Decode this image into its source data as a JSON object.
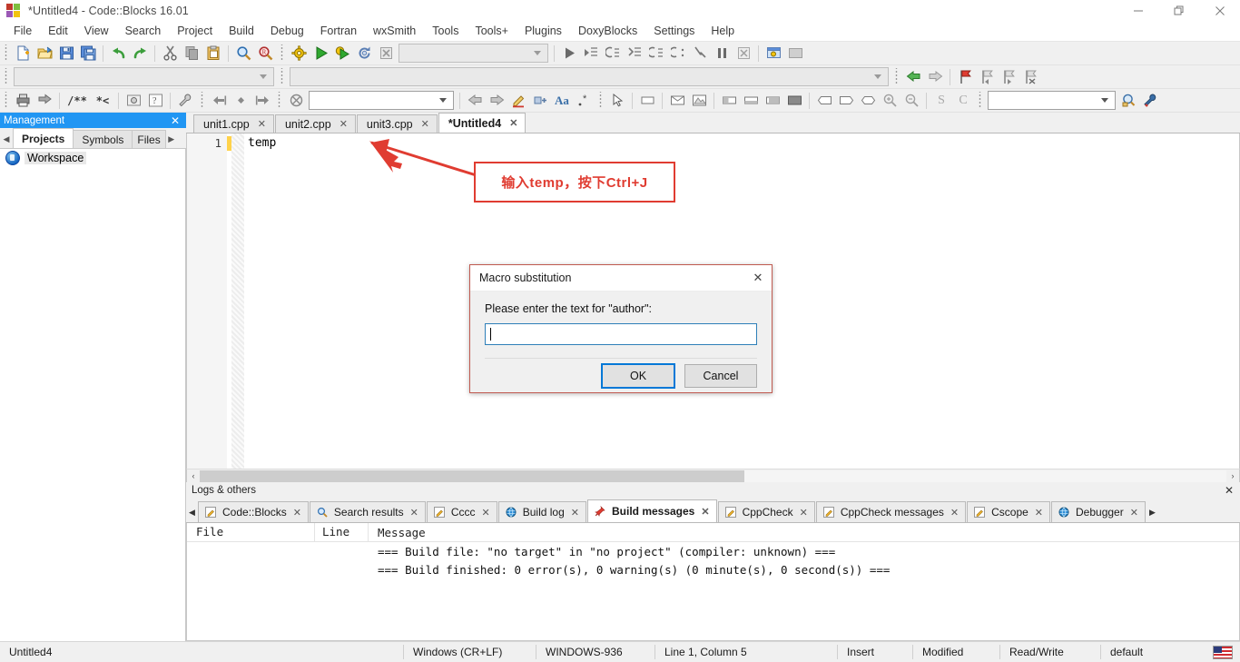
{
  "window": {
    "title": "*Untitled4 - Code::Blocks 16.01",
    "app_icon": "codeblocks-logo-icon",
    "minimize": "—",
    "maximize": "❐",
    "close": "✕"
  },
  "menubar": {
    "items": [
      {
        "label": "File"
      },
      {
        "label": "Edit"
      },
      {
        "label": "View"
      },
      {
        "label": "Search"
      },
      {
        "label": "Project"
      },
      {
        "label": "Build"
      },
      {
        "label": "Debug"
      },
      {
        "label": "Fortran"
      },
      {
        "label": "wxSmith"
      },
      {
        "label": "Tools"
      },
      {
        "label": "Tools+"
      },
      {
        "label": "Plugins"
      },
      {
        "label": "DoxyBlocks"
      },
      {
        "label": "Settings"
      },
      {
        "label": "Help"
      }
    ]
  },
  "toolbars": {
    "main": {
      "buttons": [
        "new-file-icon",
        "open-file-icon",
        "save-icon",
        "save-all-icon",
        "undo-icon",
        "redo-icon",
        "cut-icon",
        "copy-icon",
        "paste-icon",
        "find-icon",
        "replace-icon"
      ]
    },
    "compiler": {
      "buttons": [
        "build-icon",
        "run-icon",
        "build-and-run-icon",
        "rebuild-icon",
        "abort-icon"
      ],
      "target_combo_value": "",
      "target_combo_enabled": false
    },
    "debugger": {
      "buttons": [
        "debug-continue-icon",
        "run-to-cursor-icon",
        "next-line-icon",
        "step-into-icon",
        "step-out-icon",
        "next-instruction-icon",
        "step-into-instruction-icon",
        "break-debugger-icon",
        "stop-debugger-icon",
        "debugging-windows-icon",
        "various-info-icon"
      ]
    },
    "search_row": {
      "combo_value": "",
      "combo_enabled": false,
      "nav_buttons": [
        "back-icon",
        "forward-icon"
      ],
      "bookmark_buttons": [
        "toggle-bookmark-icon",
        "previous-bookmark-icon",
        "next-bookmark-icon",
        "clear-bookmarks-icon"
      ]
    },
    "doxyblocks": {
      "buttons": [
        "run-doxywizard-icon",
        "extract-documentation-icon",
        "block-comment-icon",
        "line-comment-icon",
        "doxywizard-icon",
        "preferences-icon"
      ]
    },
    "fortran": {
      "buttons": [
        "jump-back-icon",
        "jump-home-icon",
        "jump-forward-icon"
      ]
    },
    "wxsmith": {
      "buttons": [
        "wxsmith-icon",
        "back-icon",
        "forward-icon",
        "edit-icon",
        "insert-icon",
        "font-icon",
        "wildcard-icon",
        "pointer-icon",
        "panel-icon",
        "dialog-icon",
        "frame-icon",
        "sizer-h-icon",
        "sizer-v-icon",
        "sizer-grid-icon",
        "sizer-box-icon",
        "spacer-icon",
        "stretch-icon",
        "shape-icon"
      ]
    },
    "browse": {
      "buttons": [
        "zoom-in-icon",
        "zoom-out-icon",
        "symbols-icon",
        "classes-icon"
      ],
      "combo_value": "",
      "combo_enabled": true,
      "extra_buttons": [
        "search-symbol-icon",
        "settings-wrench-icon"
      ]
    }
  },
  "management": {
    "title": "Management",
    "close_icon": "✕",
    "tabs": [
      {
        "label": "Projects",
        "selected": true
      },
      {
        "label": "Symbols",
        "selected": false
      },
      {
        "label": "Files",
        "selected": false
      }
    ],
    "prev_arrow": "◀",
    "next_arrow": "▶",
    "tree": [
      {
        "label": "Workspace",
        "icon": "workspace-icon",
        "selected": true
      }
    ]
  },
  "editor": {
    "tabs": [
      {
        "label": "unit1.cpp",
        "selected": false,
        "close": "✕"
      },
      {
        "label": "unit2.cpp",
        "selected": false,
        "close": "✕"
      },
      {
        "label": "unit3.cpp",
        "selected": false,
        "close": "✕"
      },
      {
        "label": "*Untitled4",
        "selected": true,
        "close": "✕"
      }
    ],
    "lines": [
      {
        "number": "1",
        "text": "temp",
        "modified": true
      }
    ],
    "scroll_left_arrow": "‹",
    "scroll_right_arrow": "›"
  },
  "annotation": {
    "text": "输入temp，按下Ctrl+J",
    "color": "#e03c31",
    "arrow": "red-arrow-pointer"
  },
  "dialog": {
    "title": "Macro substitution",
    "close_icon": "✕",
    "prompt": "Please enter the text for \"author\":",
    "input_value": "",
    "buttons": [
      {
        "label": "OK",
        "default": true
      },
      {
        "label": "Cancel",
        "default": false
      }
    ]
  },
  "logs": {
    "title": "Logs & others",
    "close_icon": "✕",
    "prev_arrow": "◀",
    "next_arrow": "▶",
    "tabs": [
      {
        "label": "Code::Blocks",
        "icon": "pencil-icon",
        "selected": false,
        "close": "✕"
      },
      {
        "label": "Search results",
        "icon": "magnifier-icon",
        "selected": false,
        "close": "✕"
      },
      {
        "label": "Cccc",
        "icon": "pencil-icon",
        "selected": false,
        "close": "✕"
      },
      {
        "label": "Build log",
        "icon": "globe-icon",
        "selected": false,
        "close": "✕"
      },
      {
        "label": "Build messages",
        "icon": "pin-icon",
        "selected": true,
        "close": "✕"
      },
      {
        "label": "CppCheck",
        "icon": "pencil-icon",
        "selected": false,
        "close": "✕"
      },
      {
        "label": "CppCheck messages",
        "icon": "pencil-icon",
        "selected": false,
        "close": "✕"
      },
      {
        "label": "Cscope",
        "icon": "pencil-icon",
        "selected": false,
        "close": "✕"
      },
      {
        "label": "Debugger",
        "icon": "globe-icon",
        "selected": false,
        "close": "✕"
      }
    ],
    "columns": [
      "File",
      "Line",
      "Message"
    ],
    "rows": [
      {
        "file": "",
        "line": "",
        "message": "=== Build file: \"no target\" in \"no project\" (compiler: unknown) ==="
      },
      {
        "file": "",
        "line": "",
        "message": "=== Build finished: 0 error(s), 0 warning(s) (0 minute(s), 0 second(s)) ==="
      }
    ]
  },
  "statusbar": {
    "fields": [
      {
        "name": "document-name",
        "value": "Untitled4"
      },
      {
        "name": "line-ending",
        "value": "Windows (CR+LF)"
      },
      {
        "name": "encoding",
        "value": "WINDOWS-936"
      },
      {
        "name": "caret-position",
        "value": "Line 1, Column 5"
      },
      {
        "name": "insert-mode",
        "value": "Insert"
      },
      {
        "name": "modified-state",
        "value": "Modified"
      },
      {
        "name": "access-mode",
        "value": "Read/Write"
      },
      {
        "name": "personality",
        "value": "default"
      }
    ],
    "keyboard_flag": "us-flag-icon"
  },
  "watermark": ""
}
